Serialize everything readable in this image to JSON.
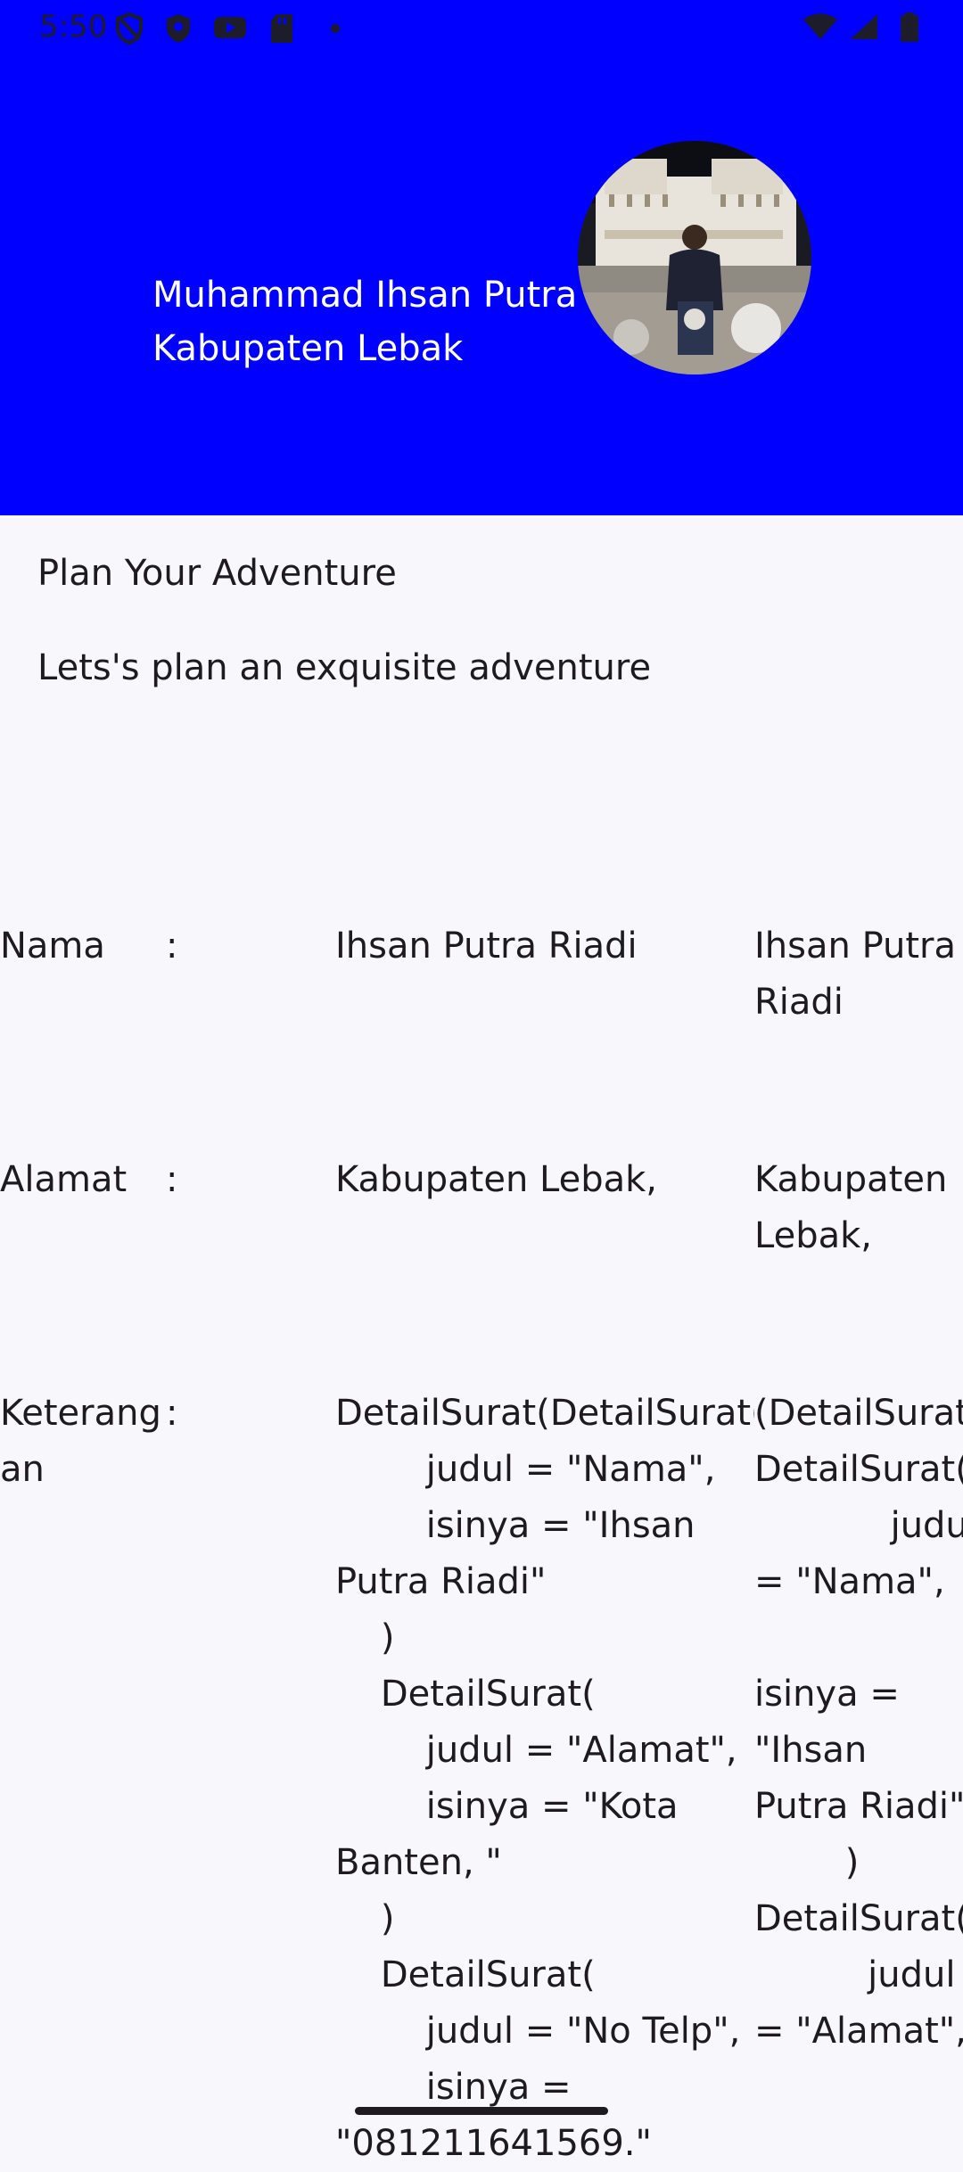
{
  "status_bar": {
    "time": "5:50",
    "left_icons": [
      "shield-icon",
      "shield-filled-icon",
      "youtube-icon",
      "sd-card-icon",
      "dot-icon"
    ],
    "right_icons": [
      "wifi-icon",
      "signal-icon",
      "battery-icon"
    ]
  },
  "header": {
    "name": "Muhammad Ihsan Putra",
    "location": "Kabupaten Lebak",
    "background_color": "#0000ff",
    "avatar_icon": "profile-photo"
  },
  "main": {
    "title": "Plan Your Adventure",
    "subtitle": "Lets's plan an exquisite adventure",
    "rows": [
      {
        "label": "Nama",
        "colon": ":",
        "value1": "Ihsan Putra Riadi",
        "value2": "Ihsan Putra\nRiadi"
      },
      {
        "label": "Alamat",
        "colon": ":",
        "value1": "Kabupaten Lebak,",
        "value2": "Kabupaten\nLebak,"
      },
      {
        "label": "Keterang\nan",
        "colon": ":",
        "value1": "DetailSurat(DetailSurat(\n        judul = \"Nama\",\n        isinya = \"Ihsan\nPutra Riadi\"\n    )\n    DetailSurat(\n        judul = \"Alamat\",\n        isinya = \"Kota\nBanten, \"\n    )\n    DetailSurat(\n        judul = \"No Telp\",\n        isinya =\n\"081211641569.\"",
        "value2": "(DetailSurat(\nDetailSurat(\n            judul\n= \"Nama\",\n\nisinya =\n\"Ihsan\nPutra Riadi\"\n        )\nDetailSurat(\n          judul\n= \"Alamat\","
      }
    ]
  }
}
